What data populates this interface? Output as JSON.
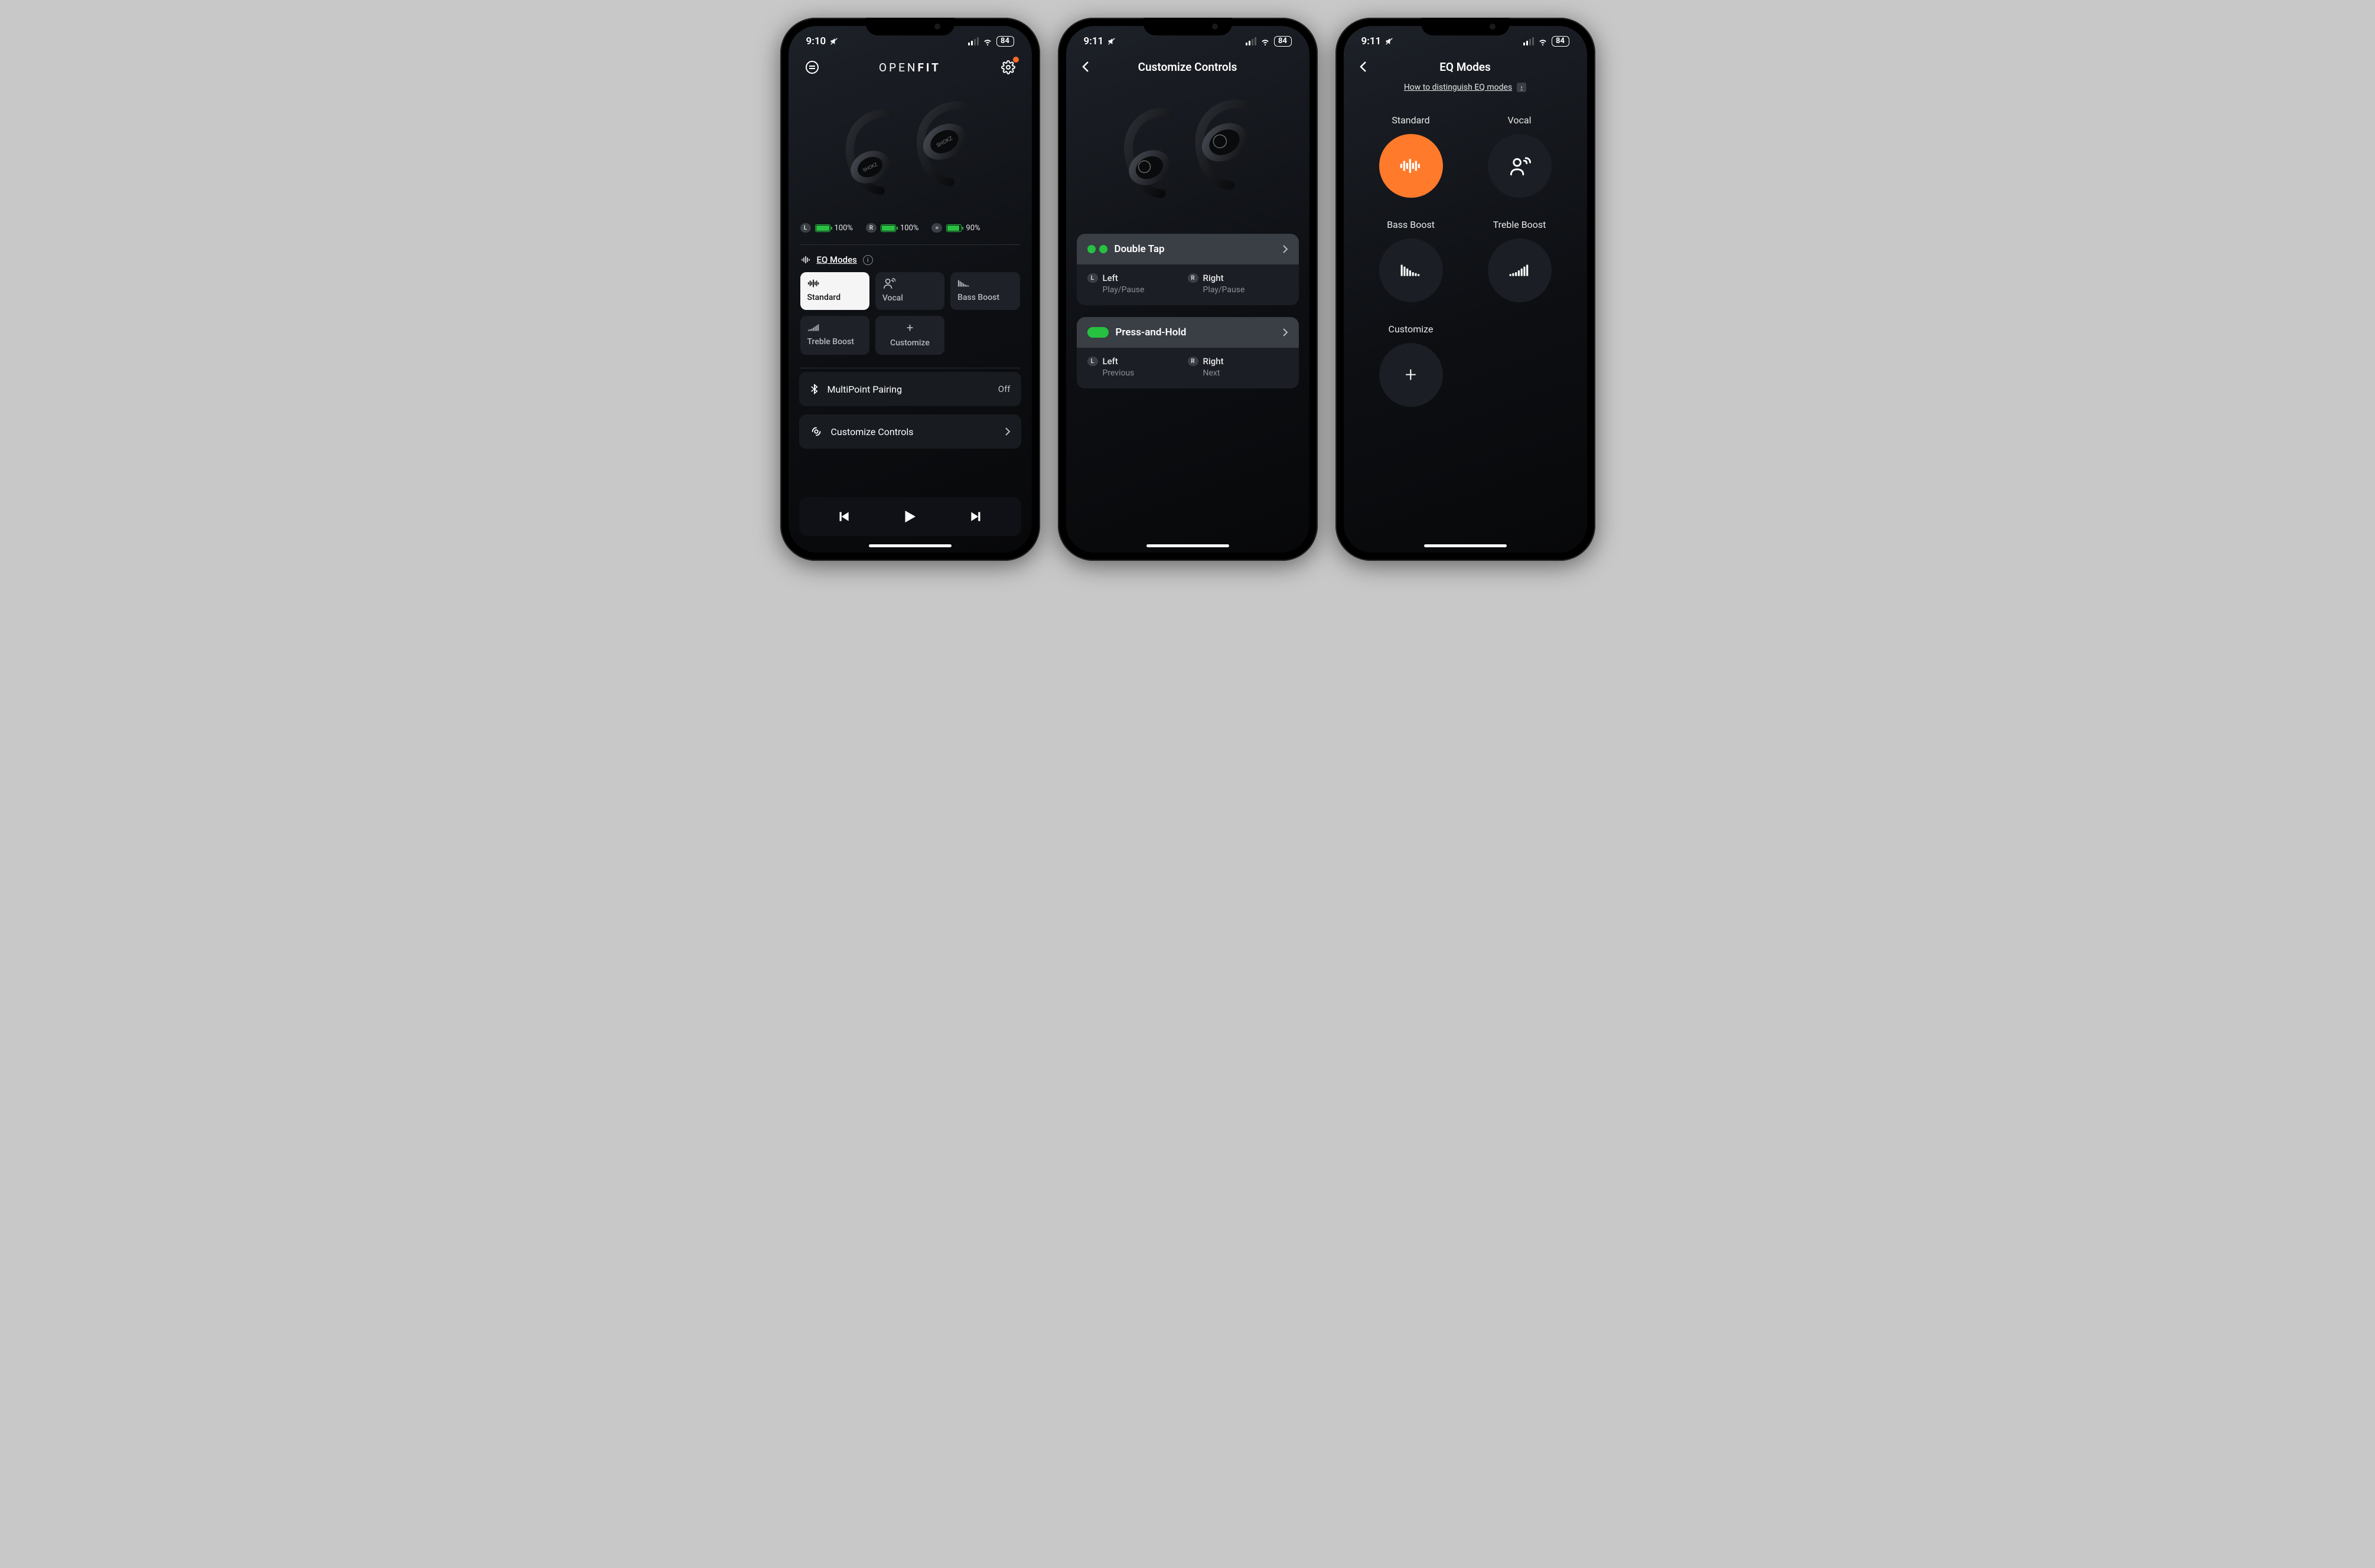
{
  "status": {
    "times": [
      "9:10",
      "9:11",
      "9:11"
    ],
    "battery": "84"
  },
  "screen1": {
    "title_a": "OPEN",
    "title_b": "FIT",
    "batteries": {
      "left": {
        "tag": "L",
        "pct": "100%",
        "fill": 100
      },
      "right": {
        "tag": "R",
        "pct": "100%",
        "fill": 100
      },
      "case": {
        "tag": "=",
        "pct": "90%",
        "fill": 90
      }
    },
    "eq_heading": "EQ Modes",
    "eq_options": [
      "Standard",
      "Vocal",
      "Bass Boost",
      "Treble Boost",
      "Customize"
    ],
    "multipoint": {
      "label": "MultiPoint Pairing",
      "value": "Off"
    },
    "customize": {
      "label": "Customize Controls"
    }
  },
  "screen2": {
    "title": "Customize Controls",
    "panels": [
      {
        "header": "Double Tap",
        "style": "dots",
        "left": {
          "side": "Left",
          "action": "Play/Pause"
        },
        "right": {
          "side": "Right",
          "action": "Play/Pause"
        }
      },
      {
        "header": "Press-and-Hold",
        "style": "pill",
        "left": {
          "side": "Left",
          "action": "Previous"
        },
        "right": {
          "side": "Right",
          "action": "Next"
        }
      }
    ]
  },
  "screen3": {
    "title": "EQ Modes",
    "helper": "How to distinguish EQ modes",
    "options": [
      "Standard",
      "Vocal",
      "Bass Boost",
      "Treble Boost",
      "Customize"
    ],
    "active_index": 0
  }
}
